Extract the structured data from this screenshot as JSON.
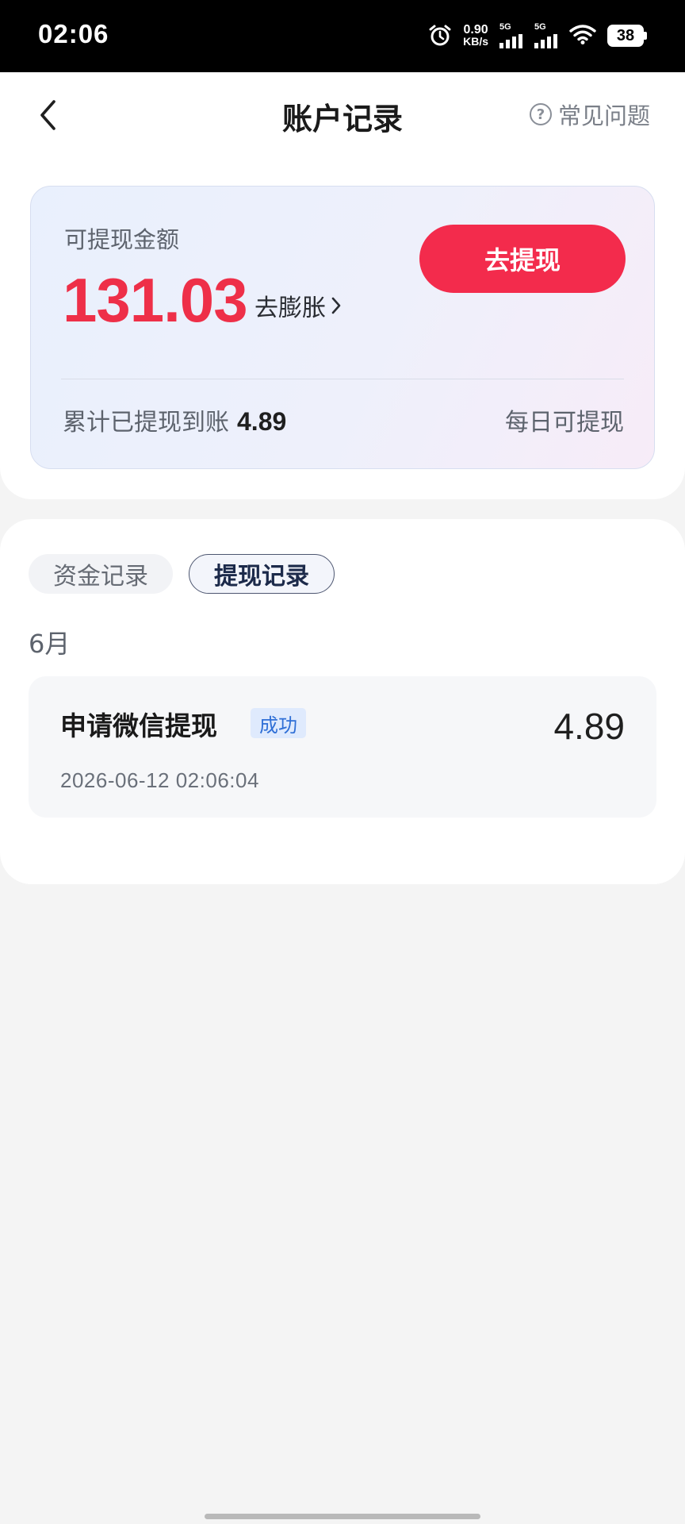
{
  "status_bar": {
    "time": "02:06",
    "net_speed_value": "0.90",
    "net_speed_unit": "KB/s",
    "signal1_label": "5G",
    "signal2_label": "5G",
    "battery_level": "38"
  },
  "nav": {
    "title": "账户记录",
    "faq_label": "常见问题"
  },
  "balance_card": {
    "label": "可提现金额",
    "amount": "131.03",
    "expand_label": "去膨胀",
    "withdraw_button_label": "去提现",
    "cumulative_label": "累计已提现到账",
    "cumulative_value": "4.89",
    "daily_note": "每日可提现",
    "accent_color": "#f32b4c"
  },
  "records": {
    "tabs": [
      {
        "label": "资金记录",
        "active": false
      },
      {
        "label": "提现记录",
        "active": true
      }
    ],
    "month": "6月",
    "items": [
      {
        "title": "申请微信提现",
        "badge": "成功",
        "amount": "4.89",
        "time": "2026-06-12 02:06:04"
      }
    ]
  }
}
